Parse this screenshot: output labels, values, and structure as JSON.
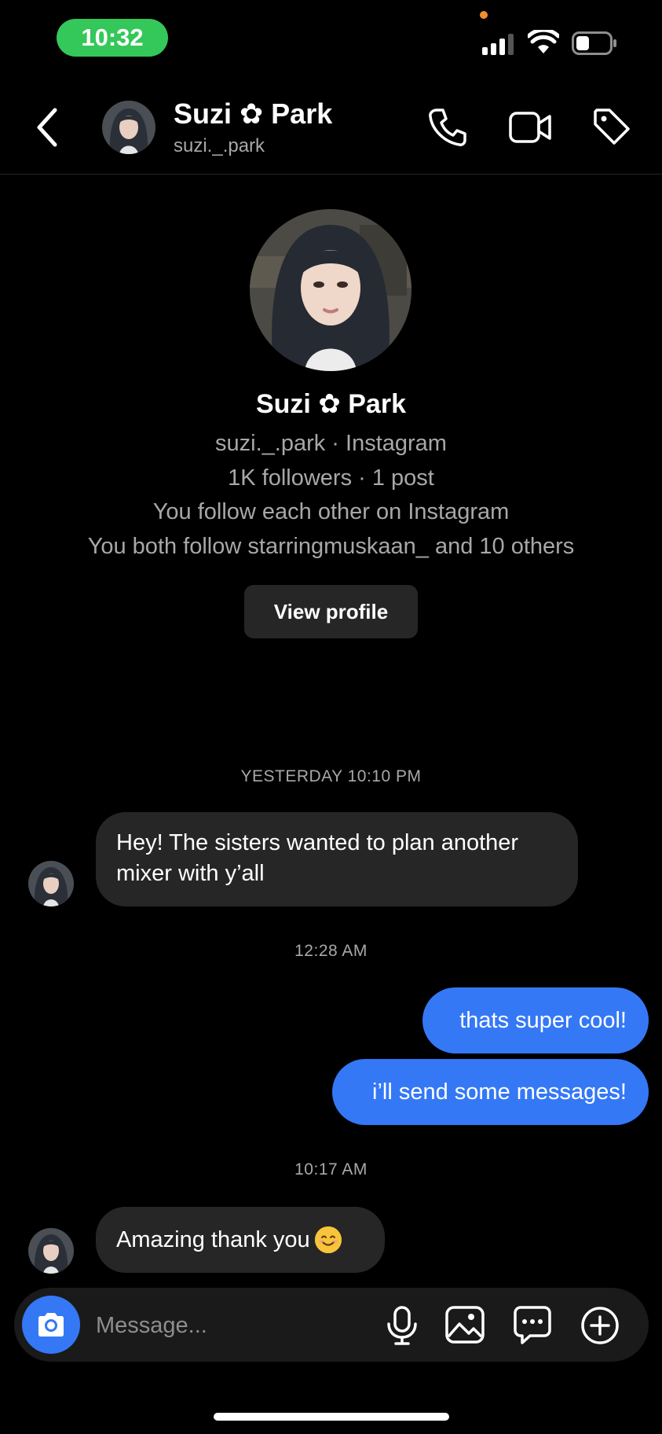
{
  "status_bar": {
    "time": "10:32"
  },
  "header": {
    "name": "Suzi ✿ Park",
    "handle": "suzi._.park",
    "icons": [
      "back-arrow-icon",
      "phone-icon",
      "video-camera-icon",
      "tag-icon"
    ]
  },
  "profile": {
    "name": "Suzi ✿ Park",
    "handle_line": "suzi._.park · Instagram",
    "stats_line": "1K followers · 1 post",
    "follow_line": "You follow each other on Instagram",
    "mutual_line": "You both follow starringmuskaan_ and 10 others",
    "view_profile_label": "View profile"
  },
  "messages": {
    "ts1": "YESTERDAY 10:10 PM",
    "m1": "Hey! The sisters wanted to plan another mixer with y’all",
    "ts2": "12:28 AM",
    "m2": "thats super cool!",
    "m3": "i’ll send some messages!",
    "ts3": "10:17 AM",
    "m4": "Amazing thank you"
  },
  "composer": {
    "placeholder": "Message...",
    "icons": [
      "camera-icon",
      "microphone-icon",
      "gallery-icon",
      "chat-bubble-icon",
      "plus-icon"
    ]
  },
  "colors": {
    "background": "#000000",
    "incoming_bubble": "#262626",
    "outgoing_bubble": "#3478f6",
    "time_pill": "#34c759",
    "secondary_text": "#a8a8a8"
  }
}
